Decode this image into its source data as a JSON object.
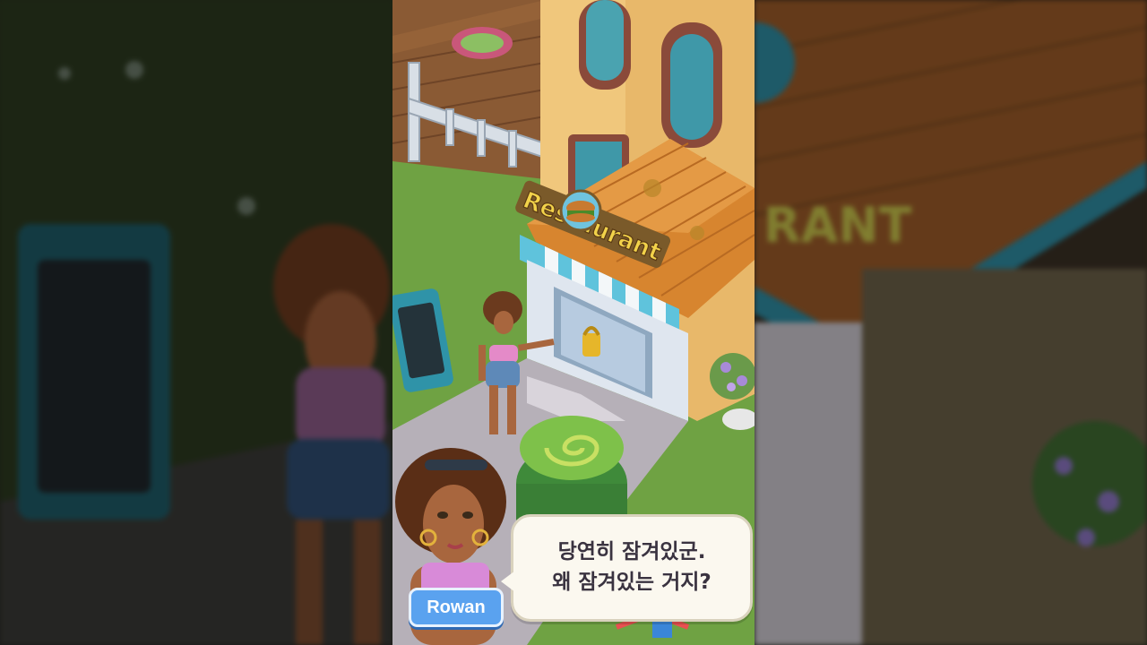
{
  "scene": {
    "sign_text": "Restaurant",
    "sign_text_side": "RANT"
  },
  "dialog": {
    "speaker": "Rowan",
    "line1": "당연히 잠겨있군.",
    "line2": "왜 잠겨있는 거지?"
  },
  "colors": {
    "grass": "#6fa243",
    "wall": "#e8b86a",
    "roof": "#d7852f",
    "awning": "#5fc3dc",
    "nametag": "#5aa2ef",
    "bubble": "#fbf8ef"
  }
}
